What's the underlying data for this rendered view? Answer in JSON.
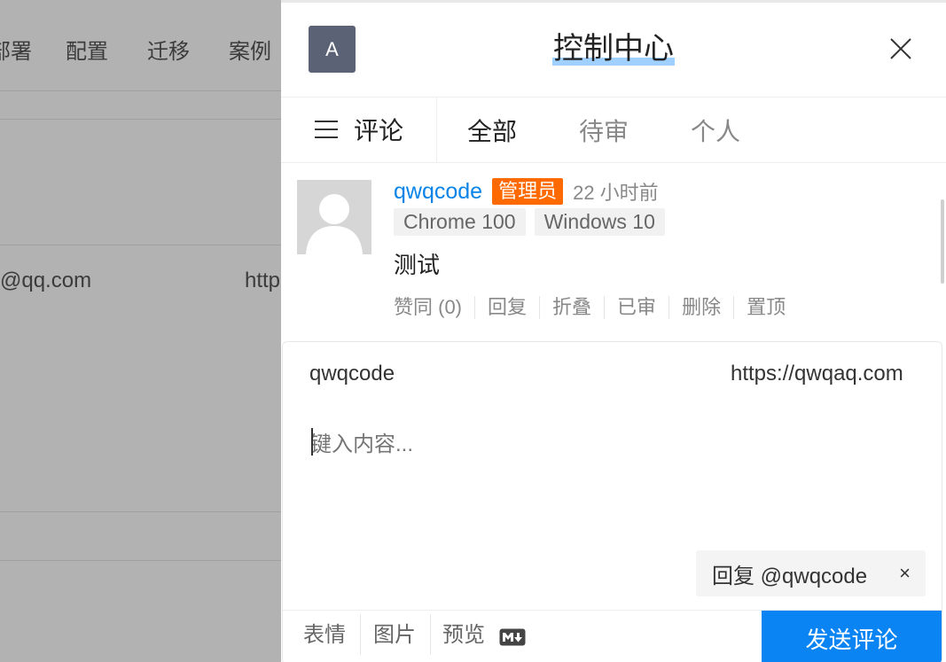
{
  "background": {
    "nav_items": [
      "部署",
      "配置",
      "迁移",
      "案例"
    ],
    "row_email": "@qq.com",
    "row_link": "http"
  },
  "drawer": {
    "avatar_letter": "A",
    "title": "控制中心",
    "tabs": {
      "menu_label": "评论",
      "all": "全部",
      "pending": "待审",
      "personal": "个人"
    }
  },
  "comment": {
    "nick": "qwqcode",
    "badge": "管理员",
    "time": "22 小时前",
    "ua": [
      "Chrome 100",
      "Windows 10"
    ],
    "content": "测试",
    "actions": [
      "赞同 (0)",
      "回复",
      "折叠",
      "已审",
      "删除",
      "置顶"
    ]
  },
  "editor": {
    "nick_value": "qwqcode",
    "link_value": "https://qwqaq.com",
    "content_placeholder": "键入内容...",
    "reply_chip": "回复 @qwqcode",
    "reply_close": "×",
    "footer": {
      "emoji": "表情",
      "image": "图片",
      "preview": "预览",
      "send": "发送评论"
    }
  },
  "colors": {
    "accent": "#0a84f2",
    "nick": "#0a84e8",
    "badge": "#ff6a00",
    "avatar": "#5b6275"
  }
}
